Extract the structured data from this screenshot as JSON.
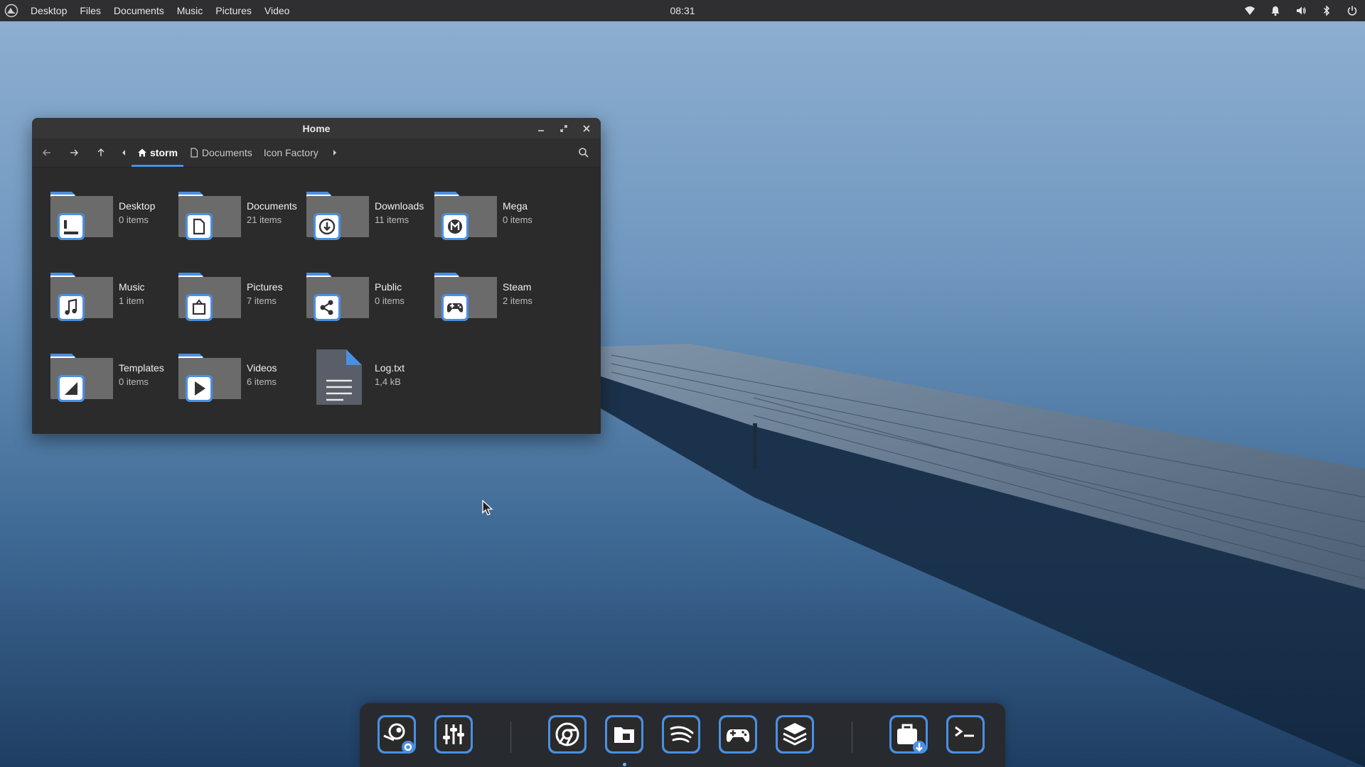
{
  "top_panel": {
    "menu": [
      "Desktop",
      "Files",
      "Documents",
      "Music",
      "Pictures",
      "Video"
    ],
    "clock": "08:31",
    "tray_icons": [
      "wifi-icon",
      "bell-icon",
      "volume-icon",
      "bluetooth-icon",
      "power-icon"
    ]
  },
  "window": {
    "title": "Home",
    "breadcrumbs": [
      "storm",
      "Documents",
      "Icon Factory"
    ],
    "active_crumb": "storm",
    "accent": "#4a90e2",
    "items": [
      {
        "name": "Desktop",
        "count": "0 items",
        "icon": "desktop-folder-icon"
      },
      {
        "name": "Documents",
        "count": "21 items",
        "icon": "documents-folder-icon"
      },
      {
        "name": "Downloads",
        "count": "11 items",
        "icon": "downloads-folder-icon"
      },
      {
        "name": "Mega",
        "count": "0 items",
        "icon": "mega-folder-icon"
      },
      {
        "name": "Music",
        "count": "1 item",
        "icon": "music-folder-icon"
      },
      {
        "name": "Pictures",
        "count": "7 items",
        "icon": "pictures-folder-icon"
      },
      {
        "name": "Public",
        "count": "0 items",
        "icon": "public-folder-icon"
      },
      {
        "name": "Steam",
        "count": "2 items",
        "icon": "steam-folder-icon"
      },
      {
        "name": "Templates",
        "count": "0 items",
        "icon": "templates-folder-icon"
      },
      {
        "name": "Videos",
        "count": "6 items",
        "icon": "videos-folder-icon"
      },
      {
        "name": "Log.txt",
        "count": "1,4 kB",
        "icon": "text-file-icon"
      }
    ]
  },
  "dock": {
    "apps": [
      "steam-settings-icon",
      "mixer-icon",
      "chrome-icon",
      "files-icon",
      "spotify-icon",
      "gamepad-icon",
      "layers-icon",
      "package-installer-icon",
      "terminal-icon"
    ],
    "running": "files-icon"
  }
}
